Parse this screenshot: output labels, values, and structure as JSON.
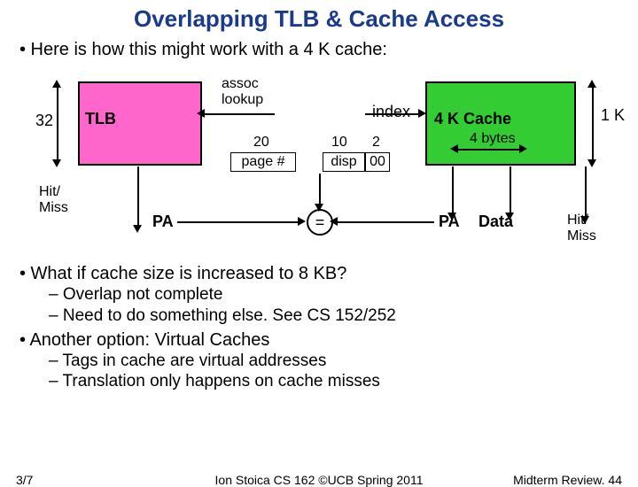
{
  "title": "Overlapping TLB & Cache Access",
  "intro": "• Here is how this might work with a 4 K cache:",
  "diagram": {
    "tlb_width": "32",
    "tlb_label": "TLB",
    "assoc": "assoc\nlookup",
    "index": "index",
    "cache_label": "4 K Cache",
    "cache_width": "1 K",
    "page_bits": "20",
    "page_label": "page #",
    "disp_bits": "10",
    "disp_bits2": "2",
    "disp_label": "disp",
    "zero_label": "00",
    "bytes_label": "4 bytes",
    "hitmiss": "Hit/\nMiss",
    "pa": "PA",
    "eq": "=",
    "pa2": "PA",
    "data": "Data",
    "hitmiss2": "Hit/\nMiss"
  },
  "q1": "• What if cache size is increased to 8 KB?",
  "q1_sub1": "– Overlap not complete",
  "q1_sub2": "– Need to do something else.  See CS 152/252",
  "q2": "• Another option: Virtual Caches",
  "q2_sub1": "– Tags in cache are virtual addresses",
  "q2_sub2": "– Translation only happens on cache misses",
  "footer": {
    "left": "3/7",
    "center": "Ion Stoica CS 162 ©UCB Spring 2011",
    "right": "Midterm Review. 44"
  }
}
